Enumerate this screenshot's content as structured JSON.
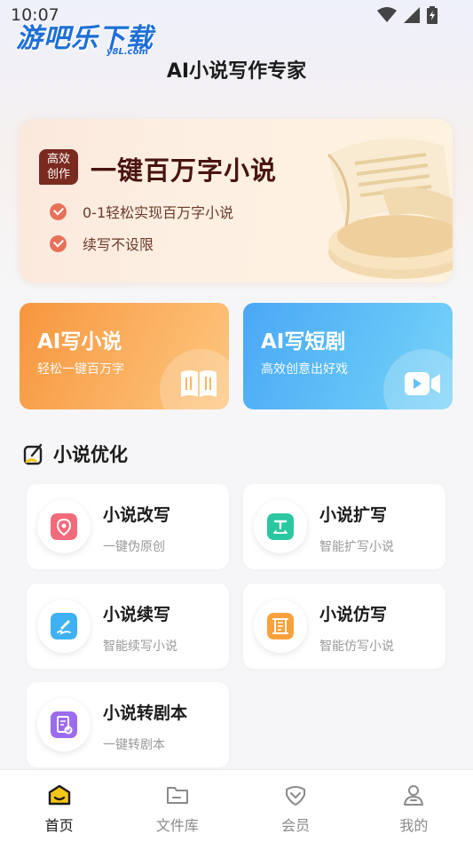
{
  "status_bar": {
    "time": "10:07"
  },
  "watermark": {
    "text": "游吧乐下载",
    "sub": "y8L.com"
  },
  "header": {
    "title": "AI小说写作专家"
  },
  "banner": {
    "badge_line1": "高效",
    "badge_line2": "创作",
    "title": "一键百万字小说",
    "points": [
      "0-1轻松实现百万字小说",
      "续写不设限"
    ]
  },
  "feature_cards": [
    {
      "title": "AI写小说",
      "subtitle": "轻松一键百万字",
      "icon": "book-icon"
    },
    {
      "title": "AI写短剧",
      "subtitle": "高效创意出好戏",
      "icon": "video-icon"
    }
  ],
  "section": {
    "title": "小说优化"
  },
  "tools": [
    {
      "title": "小说改写",
      "desc": "一键伪原创",
      "icon": "location-pin-icon",
      "color": "#f26b7a"
    },
    {
      "title": "小说扩写",
      "desc": "智能扩写小说",
      "icon": "text-expand-icon",
      "color": "#2bc7a0"
    },
    {
      "title": "小说续写",
      "desc": "智能续写小说",
      "icon": "pen-icon",
      "color": "#3fb1f2"
    },
    {
      "title": "小说仿写",
      "desc": "智能仿写小说",
      "icon": "scroll-icon",
      "color": "#f9a13c"
    },
    {
      "title": "小说转剧本",
      "desc": "一键转剧本",
      "icon": "script-icon",
      "color": "#9b6cf0"
    }
  ],
  "bottom_nav": [
    {
      "label": "首页",
      "icon": "home-icon",
      "active": true
    },
    {
      "label": "文件库",
      "icon": "folder-icon",
      "active": false
    },
    {
      "label": "会员",
      "icon": "vip-icon",
      "active": false
    },
    {
      "label": "我的",
      "icon": "profile-icon",
      "active": false
    }
  ],
  "colors": {
    "accent": "#f5c518",
    "banner_title": "#4a1410",
    "check": "#e8705a",
    "card_orange": "#f7963e",
    "card_blue": "#4aa8f5"
  }
}
